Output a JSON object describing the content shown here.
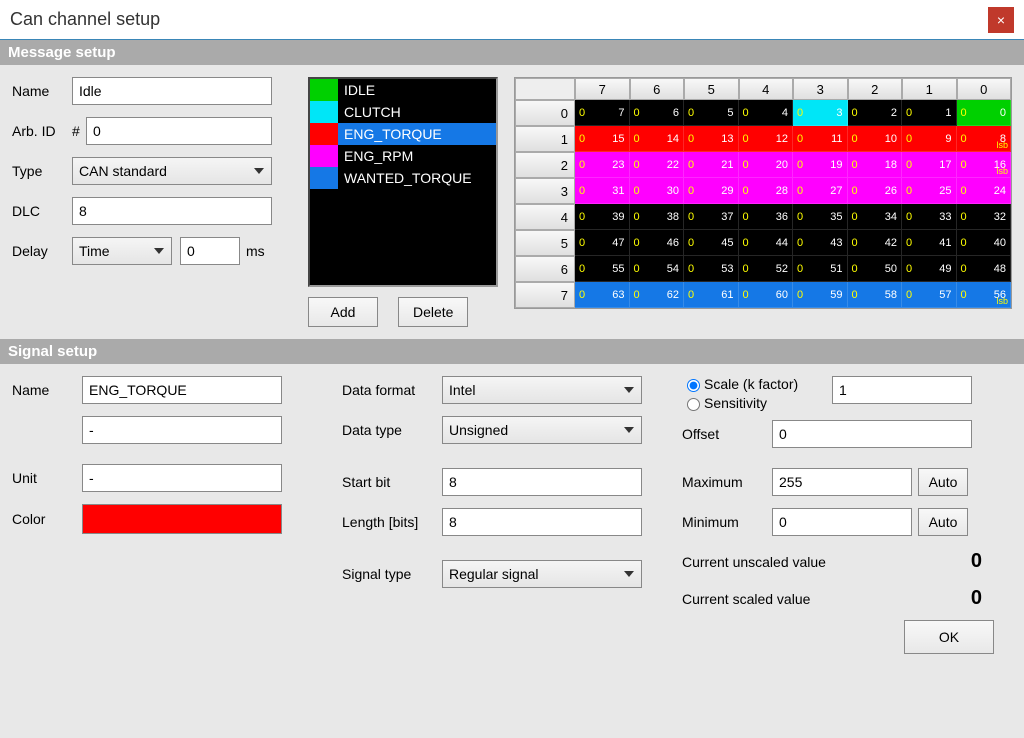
{
  "window": {
    "title": "Can channel setup",
    "close": "×"
  },
  "sections": {
    "message": "Message setup",
    "signal": "Signal setup"
  },
  "message": {
    "labels": {
      "name": "Name",
      "arb_id": "Arb. ID",
      "hash": "#",
      "type": "Type",
      "dlc": "DLC",
      "delay": "Delay",
      "ms": "ms"
    },
    "values": {
      "name": "Idle",
      "arb_id": "0",
      "type": "CAN standard",
      "dlc": "8",
      "delay_mode": "Time",
      "delay_value": "0"
    },
    "signal_list": [
      {
        "name": "IDLE",
        "color": "#00d000",
        "selected": false
      },
      {
        "name": "CLUTCH",
        "color": "#00e6f7",
        "selected": false
      },
      {
        "name": "ENG_TORQUE",
        "color": "#ff0000",
        "selected": true
      },
      {
        "name": "ENG_RPM",
        "color": "#ff00ff",
        "selected": false
      },
      {
        "name": "WANTED_TORQUE",
        "color": "#1578e6",
        "selected": false
      }
    ],
    "buttons": {
      "add": "Add",
      "delete": "Delete"
    },
    "grid": {
      "cols": [
        "7",
        "6",
        "5",
        "4",
        "3",
        "2",
        "1",
        "0"
      ],
      "rows": [
        "0",
        "1",
        "2",
        "3",
        "4",
        "5",
        "6",
        "7"
      ],
      "row_colors": [
        "#000000",
        "#ff0000",
        "#ff00ff",
        "#ff00ff",
        "#000000",
        "#000000",
        "#000000",
        "#1578e6"
      ],
      "cell_overrides": {
        "0.4": "#00e6f7",
        "0.7": "#00d000"
      },
      "lsb_markers": {
        "1.7": "lsb",
        "2.7": "lsb",
        "3.7": "",
        "7.7": "lsb"
      },
      "fg_num": {
        "0": "#ffffff",
        "1": "#ffffff",
        "2": "#ffffff",
        "3": "#ffffff",
        "4": "#ffffff",
        "5": "#ffffff",
        "6": "#ffffff",
        "7": "#ffffff"
      }
    }
  },
  "signal": {
    "labels": {
      "name": "Name",
      "unit": "Unit",
      "color": "Color",
      "data_format": "Data format",
      "data_type": "Data type",
      "start_bit": "Start bit",
      "length": "Length [bits]",
      "signal_type": "Signal type",
      "scale": "Scale (k factor)",
      "sensitivity": "Sensitivity",
      "offset": "Offset",
      "maximum": "Maximum",
      "minimum": "Minimum",
      "auto": "Auto",
      "unscaled": "Current unscaled value",
      "scaled": "Current scaled value"
    },
    "values": {
      "name": "ENG_TORQUE",
      "desc": "-",
      "unit": "-",
      "color": "#ff0000",
      "data_format": "Intel",
      "data_type": "Unsigned",
      "start_bit": "8",
      "length": "8",
      "signal_type": "Regular signal",
      "scale_mode": "scale",
      "scale": "1",
      "offset": "0",
      "maximum": "255",
      "minimum": "0",
      "unscaled_value": "0",
      "scaled_value": "0"
    }
  },
  "footer": {
    "ok": "OK"
  }
}
